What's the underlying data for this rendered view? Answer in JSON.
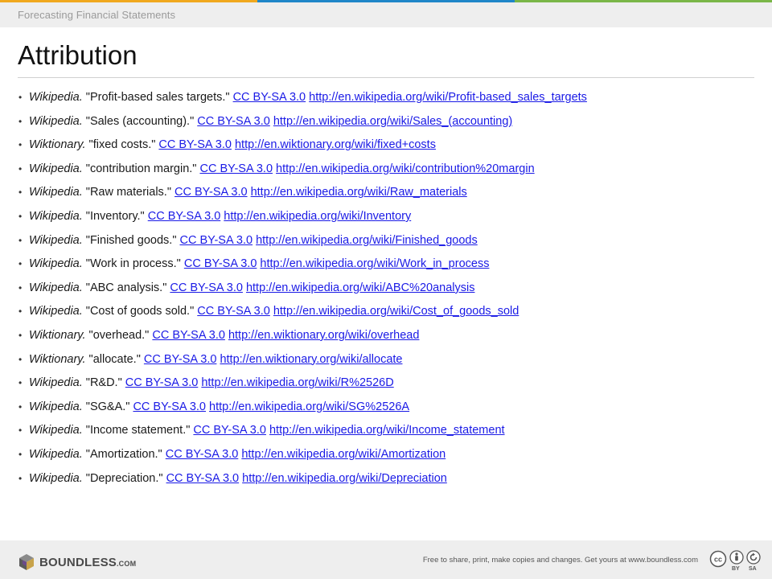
{
  "theme": {
    "stripe_colors": [
      "#f0a81e",
      "#1f86c8",
      "#7ab648"
    ],
    "link_color": "#1a1ae6",
    "header_bg": "#eeeeee"
  },
  "header": {
    "title": "Forecasting Financial Statements"
  },
  "page": {
    "title": "Attribution"
  },
  "references": [
    {
      "source": "Wikipedia.",
      "title": "\"Profit-based sales targets.\"",
      "license": "CC BY-SA 3.0",
      "url": "http://en.wikipedia.org/wiki/Profit-based_sales_targets"
    },
    {
      "source": "Wikipedia.",
      "title": "\"Sales (accounting).\"",
      "license": "CC BY-SA 3.0",
      "url": "http://en.wikipedia.org/wiki/Sales_(accounting)"
    },
    {
      "source": "Wiktionary.",
      "title": "\"fixed costs.\"",
      "license": "CC BY-SA 3.0",
      "url": "http://en.wiktionary.org/wiki/fixed+costs"
    },
    {
      "source": "Wikipedia.",
      "title": "\"contribution margin.\"",
      "license": "CC BY-SA 3.0",
      "url": "http://en.wikipedia.org/wiki/contribution%20margin"
    },
    {
      "source": "Wikipedia.",
      "title": "\"Raw materials.\"",
      "license": "CC BY-SA 3.0",
      "url": "http://en.wikipedia.org/wiki/Raw_materials"
    },
    {
      "source": "Wikipedia.",
      "title": "\"Inventory.\"",
      "license": "CC BY-SA 3.0",
      "url": "http://en.wikipedia.org/wiki/Inventory"
    },
    {
      "source": "Wikipedia.",
      "title": "\"Finished goods.\"",
      "license": "CC BY-SA 3.0",
      "url": "http://en.wikipedia.org/wiki/Finished_goods"
    },
    {
      "source": "Wikipedia.",
      "title": "\"Work in process.\"",
      "license": "CC BY-SA 3.0",
      "url": "http://en.wikipedia.org/wiki/Work_in_process"
    },
    {
      "source": "Wikipedia.",
      "title": "\"ABC analysis.\"",
      "license": "CC BY-SA 3.0",
      "url": "http://en.wikipedia.org/wiki/ABC%20analysis"
    },
    {
      "source": "Wikipedia.",
      "title": "\"Cost of goods sold.\"",
      "license": "CC BY-SA 3.0",
      "url": "http://en.wikipedia.org/wiki/Cost_of_goods_sold"
    },
    {
      "source": "Wiktionary.",
      "title": "\"overhead.\"",
      "license": "CC BY-SA 3.0",
      "url": "http://en.wiktionary.org/wiki/overhead"
    },
    {
      "source": "Wiktionary.",
      "title": "\"allocate.\"",
      "license": "CC BY-SA 3.0",
      "url": "http://en.wiktionary.org/wiki/allocate"
    },
    {
      "source": "Wikipedia.",
      "title": "\"R&D.\"",
      "license": "CC BY-SA 3.0",
      "url": "http://en.wikipedia.org/wiki/R%2526D"
    },
    {
      "source": "Wikipedia.",
      "title": "\"SG&A.\"",
      "license": "CC BY-SA 3.0",
      "url": "http://en.wikipedia.org/wiki/SG%2526A"
    },
    {
      "source": "Wikipedia.",
      "title": "\"Income statement.\"",
      "license": "CC BY-SA 3.0",
      "url": "http://en.wikipedia.org/wiki/Income_statement"
    },
    {
      "source": "Wikipedia.",
      "title": "\"Amortization.\"",
      "license": "CC BY-SA 3.0",
      "url": "http://en.wikipedia.org/wiki/Amortization"
    },
    {
      "source": "Wikipedia.",
      "title": "\"Depreciation.\"",
      "license": "CC BY-SA 3.0",
      "url": "http://en.wikipedia.org/wiki/Depreciation"
    }
  ],
  "footer": {
    "logo_text": "BOUNDLESS",
    "logo_suffix": ".COM",
    "logo_icon": "boundless-cube-icon",
    "notice": "Free to share, print, make copies and changes. Get yours at www.boundless.com",
    "license_icons": [
      "cc-icon",
      "by-icon",
      "sa-icon"
    ],
    "license_labels": [
      "BY",
      "SA"
    ]
  }
}
